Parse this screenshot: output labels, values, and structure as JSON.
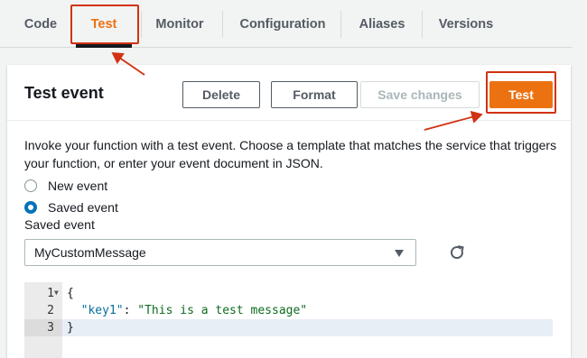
{
  "tabs": [
    {
      "label": "Code",
      "active": false
    },
    {
      "label": "Test",
      "active": true
    },
    {
      "label": "Monitor",
      "active": false
    },
    {
      "label": "Configuration",
      "active": false
    },
    {
      "label": "Aliases",
      "active": false
    },
    {
      "label": "Versions",
      "active": false
    }
  ],
  "panel": {
    "title": "Test event",
    "buttons": {
      "delete": "Delete",
      "format": "Format",
      "save_changes": "Save changes",
      "test": "Test"
    },
    "description": "Invoke your function with a test event. Choose a template that matches the service that triggers your function, or enter your event document in JSON.",
    "radios": [
      {
        "label": "New event",
        "checked": false
      },
      {
        "label": "Saved event",
        "checked": true
      }
    ],
    "saved_event_label": "Saved event",
    "saved_event_value": "MyCustomMessage"
  },
  "editor": {
    "lines": [
      {
        "number": "1",
        "text": "{"
      },
      {
        "number": "2",
        "key": "\"key1\"",
        "sep": ": ",
        "value": "\"This is a test message\""
      },
      {
        "number": "3",
        "text": "}"
      }
    ]
  },
  "colors": {
    "accent": "#ec7211",
    "highlight": "#d13212",
    "radio_selected": "#0073bb"
  },
  "icons": {
    "refresh": "refresh-icon",
    "dropdown": "caret-down-icon",
    "fold": "fold-caret-icon"
  }
}
